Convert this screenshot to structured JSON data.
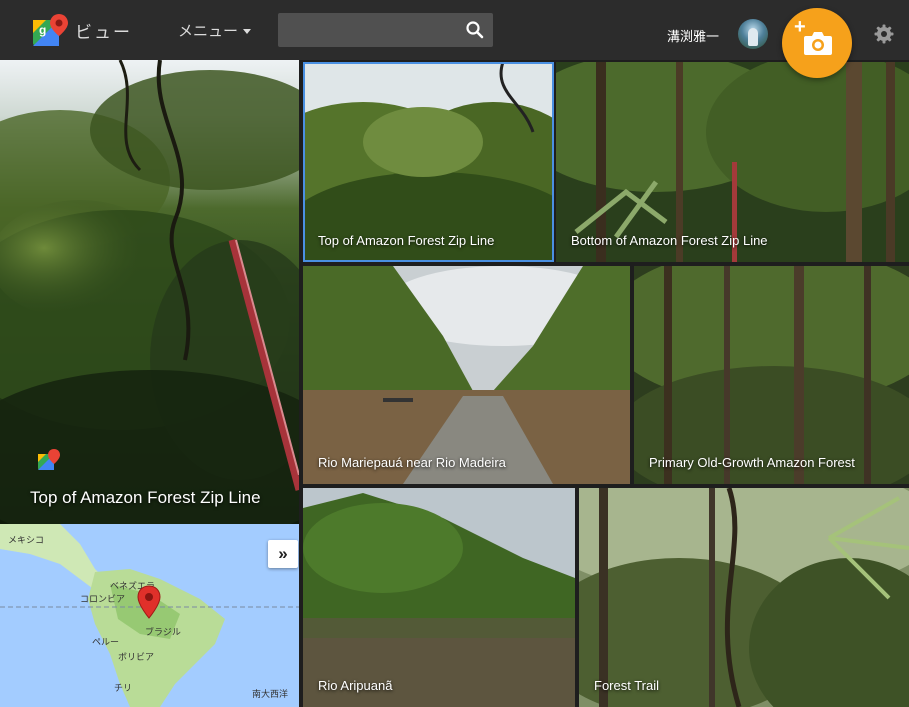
{
  "header": {
    "brand": "ビュー",
    "menu_label": "メニュー",
    "search": {
      "value": "",
      "placeholder": ""
    },
    "username": "溝渕雅一"
  },
  "hero": {
    "caption": "Top of Amazon Forest Zip Line"
  },
  "tiles": [
    {
      "caption": "Top of Amazon Forest Zip Line",
      "selected": true
    },
    {
      "caption": "Bottom of Amazon Forest Zip Line"
    },
    {
      "caption": "Rio Mariepauá near Rio Madeira"
    },
    {
      "caption": "Primary Old-Growth Amazon Forest"
    },
    {
      "caption": "Rio Aripuanã"
    },
    {
      "caption": "Forest Trail"
    }
  ],
  "map": {
    "labels": {
      "mexico": "メキシコ",
      "venezuela": "ベネズエラ",
      "colombia": "コロンビア",
      "peru": "ペルー",
      "brazil": "ブラジル",
      "bolivia": "ボリビア",
      "chile": "チリ",
      "south_atlantic": "南大西洋"
    },
    "expand_label": "»"
  },
  "colors": {
    "accent": "#f6a11b",
    "selection": "#4a90e2",
    "topbar": "#2c2c2c"
  }
}
